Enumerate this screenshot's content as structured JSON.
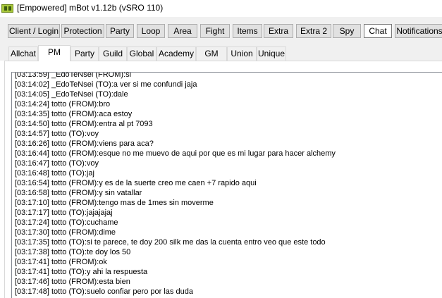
{
  "window": {
    "title": "[Empowered] mBot v1.12b (vSRO 110)",
    "icon": "mbot-app-icon"
  },
  "main_tabs": [
    {
      "label": "Client / Login"
    },
    {
      "label": "Protection"
    },
    {
      "label": "Party"
    },
    {
      "label": "Loop"
    },
    {
      "label": "Area"
    },
    {
      "label": "Fight"
    },
    {
      "label": "Items"
    },
    {
      "label": "Extra"
    },
    {
      "label": "Extra 2"
    },
    {
      "label": "Spy"
    },
    {
      "label": "Chat"
    },
    {
      "label": "Notifications"
    }
  ],
  "main_active_tab": "Chat",
  "chat_tabs": [
    {
      "label": "Allchat"
    },
    {
      "label": "PM"
    },
    {
      "label": "Party"
    },
    {
      "label": "Guild"
    },
    {
      "label": "Global"
    },
    {
      "label": "Academy"
    },
    {
      "label": "GM"
    },
    {
      "label": "Union"
    },
    {
      "label": "Unique"
    }
  ],
  "chat_active_tab": "PM",
  "messages": [
    "[03:13:59] _EdoTeNsei (FROM):si",
    "[03:14:02] _EdoTeNsei (TO):a ver si me confundi jaja",
    "[03:14:05] _EdoTeNsei (TO):dale",
    "[03:14:24] totto (FROM):bro",
    "[03:14:35] totto (FROM):aca estoy",
    "[03:14:50] totto (FROM):entra al pt 7093",
    "[03:14:57] totto (TO):voy",
    "[03:16:26] totto (FROM):viens para aca?",
    "[03:16:44] totto (FROM):esque no me muevo de aqui por que es mi lugar para hacer alchemy",
    "[03:16:47] totto (TO):voy",
    "[03:16:48] totto (TO):jaj",
    "[03:16:54] totto (FROM):y es de la suerte creo me caen +7 rapido aqui",
    "[03:16:58] totto (FROM):y sin vatallar",
    "[03:17:10] totto (FROM):tengo mas de 1mes sin moverme",
    "[03:17:17] totto (TO):jajajajaj",
    "[03:17:24] totto (TO):cuchame",
    "[03:17:30] totto (FROM):dime",
    "[03:17:35] totto (TO):si te parece, te doy 200 silk me das la cuenta entro veo que este todo",
    "[03:17:38] totto (TO):te doy los 50",
    "[03:17:41] totto (FROM):ok",
    "[03:17:41] totto (TO):y ahi la respuesta",
    "[03:17:46] totto (FROM):esta bien",
    "[03:17:48] totto (TO):suelo confiar pero por las duda"
  ]
}
